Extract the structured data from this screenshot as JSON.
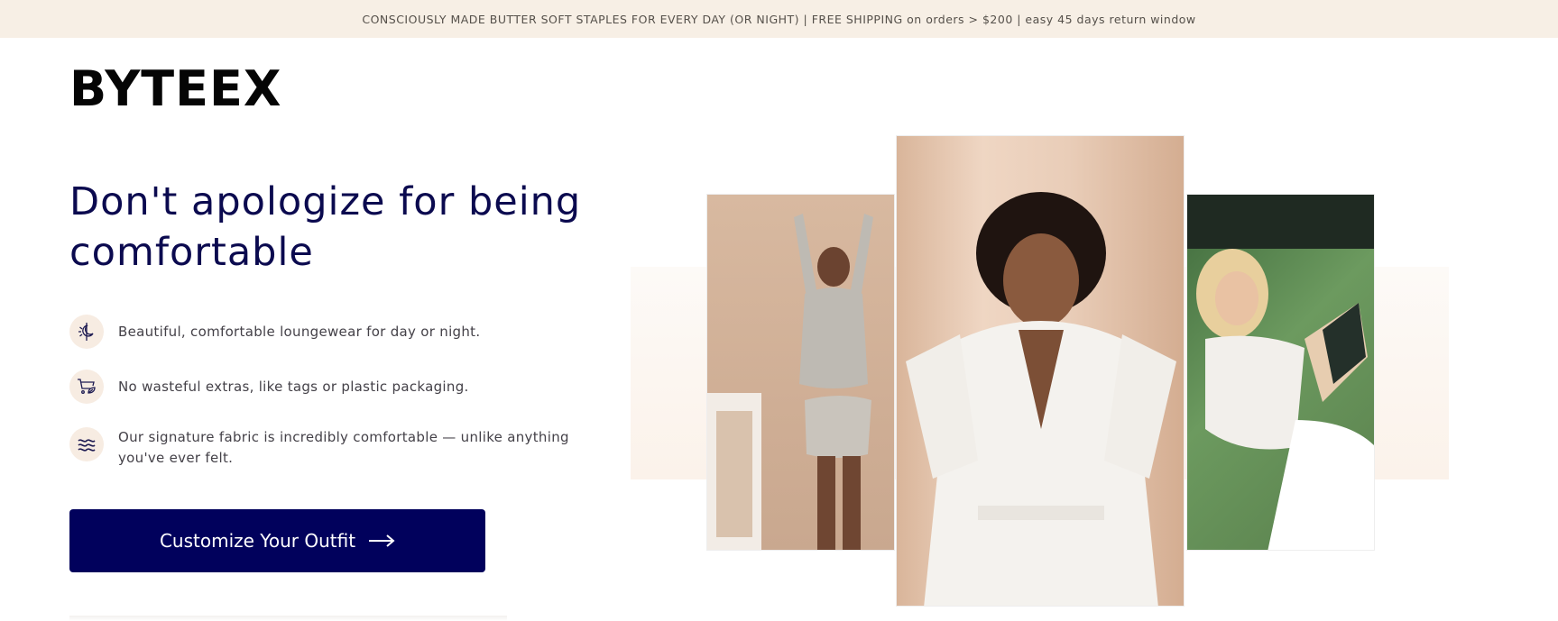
{
  "announcement": "CONSCIOUSLY MADE BUTTER SOFT STAPLES FOR EVERY DAY (OR NIGHT) | FREE SHIPPING on orders > $200 | easy 45 days return window",
  "brand": {
    "logo": "BYTEEX"
  },
  "hero": {
    "headline": "Don't apologize for being comfortable",
    "features": [
      {
        "icon": "sun-moon-icon",
        "text": "Beautiful, comfortable loungewear for day or night."
      },
      {
        "icon": "cart-leaf-icon",
        "text": "No wasteful extras, like tags or plastic packaging."
      },
      {
        "icon": "waves-icon",
        "text": "Our signature fabric is incredibly comfortable — unlike anything you've ever felt."
      }
    ],
    "cta_label": "Customize Your Outfit",
    "cta_icon": "arrow-right-icon"
  },
  "colors": {
    "navy": "#01015c",
    "headline": "#0b0a4f",
    "announce_bg": "#f7efe5",
    "icon_bg": "#f7ece2"
  }
}
